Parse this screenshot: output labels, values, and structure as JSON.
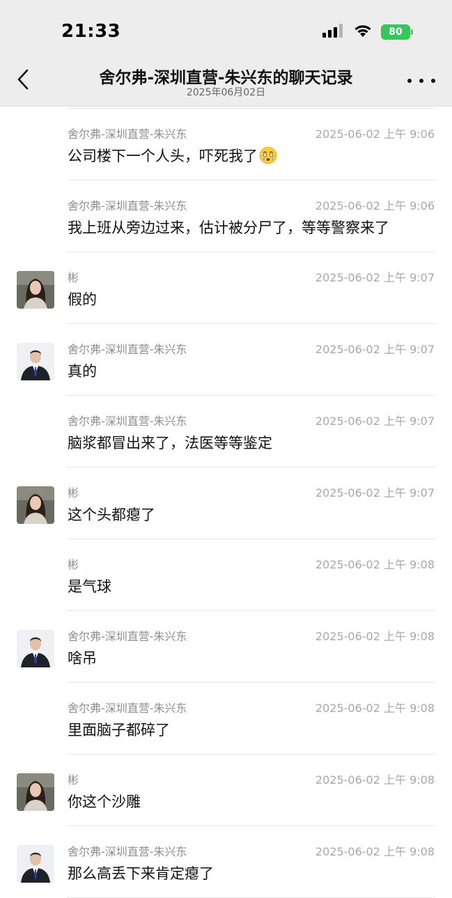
{
  "status_bar": {
    "time": "21:33",
    "battery_level": "80",
    "icons": [
      "cellular-signal-icon",
      "wifi-icon",
      "battery-charging-icon"
    ]
  },
  "nav": {
    "title": "舍尔弗-深圳直营-朱兴东的聊天记录",
    "subtitle": "2025年06月02日",
    "back_icon": "chevron-left-icon",
    "more_icon": "more-dots-icon"
  },
  "colors": {
    "nav_background": "#ededed",
    "battery_green": "#34c759",
    "sender_text": "#8e8e8e",
    "timestamp_text": "#a8a8a8",
    "separator": "#e6e6e6"
  },
  "messages": [
    {
      "sender": "舍尔弗-深圳直营-朱兴东",
      "time": "2025-06-02 上午 9:06",
      "text": "公司楼下一个人头，吓死我了",
      "emoji": "teary-face-emoji",
      "avatar": "none"
    },
    {
      "sender": "舍尔弗-深圳直营-朱兴东",
      "time": "2025-06-02 上午 9:06",
      "text": "我上班从旁边过来，估计被分尸了，等等警察来了",
      "avatar": "none"
    },
    {
      "sender": "彬",
      "time": "2025-06-02 上午 9:07",
      "text": "假的",
      "avatar": "woman-avatar"
    },
    {
      "sender": "舍尔弗-深圳直营-朱兴东",
      "time": "2025-06-02 上午 9:07",
      "text": "真的",
      "avatar": "man-avatar"
    },
    {
      "sender": "舍尔弗-深圳直营-朱兴东",
      "time": "2025-06-02 上午 9:07",
      "text": "脑浆都冒出来了，法医等等鉴定",
      "avatar": "none"
    },
    {
      "sender": "彬",
      "time": "2025-06-02 上午 9:07",
      "text": "这个头都瘪了",
      "avatar": "woman-avatar"
    },
    {
      "sender": "彬",
      "time": "2025-06-02 上午 9:08",
      "text": "是气球",
      "avatar": "none"
    },
    {
      "sender": "舍尔弗-深圳直营-朱兴东",
      "time": "2025-06-02 上午 9:08",
      "text": "啥吊",
      "avatar": "man-avatar"
    },
    {
      "sender": "舍尔弗-深圳直营-朱兴东",
      "time": "2025-06-02 上午 9:08",
      "text": "里面脑子都碎了",
      "avatar": "none"
    },
    {
      "sender": "彬",
      "time": "2025-06-02 上午 9:08",
      "text": "你这个沙雕",
      "avatar": "woman-avatar"
    },
    {
      "sender": "舍尔弗-深圳直营-朱兴东",
      "time": "2025-06-02 上午 9:08",
      "text": "那么高丢下来肯定瘪了",
      "avatar": "man-avatar"
    }
  ]
}
